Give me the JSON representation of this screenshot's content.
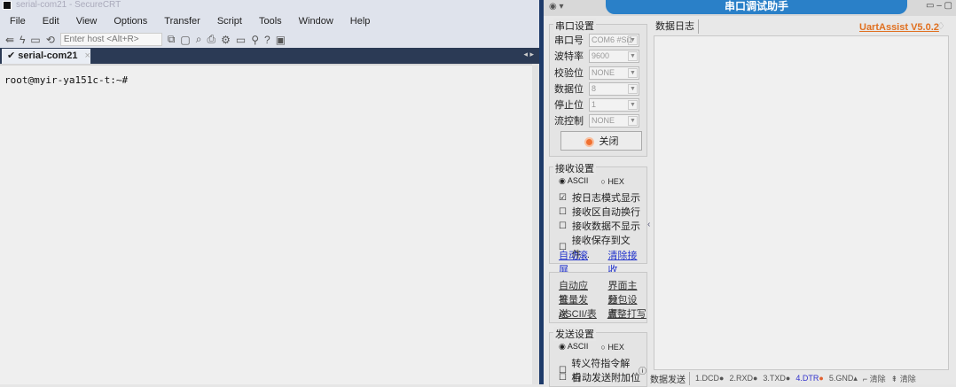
{
  "securecrt": {
    "window_title": "serial-com21 - SecureCRT",
    "menu": [
      "File",
      "Edit",
      "View",
      "Options",
      "Transfer",
      "Script",
      "Tools",
      "Window",
      "Help"
    ],
    "host_placeholder": "Enter host <Alt+R>",
    "tab_label": "serial-com21",
    "tab_close": "×",
    "terminal_text": "root@myir-ya151c-t:~#"
  },
  "uart": {
    "title": "串口调试助手",
    "version_link": "UartAssist V5.0.2",
    "log_tab": "数据日志",
    "port_settings": {
      "title": "串口设置",
      "fields": [
        {
          "label": "串口号",
          "value": "COM6 #Si1"
        },
        {
          "label": "波特率",
          "value": "9600"
        },
        {
          "label": "校验位",
          "value": "NONE"
        },
        {
          "label": "数据位",
          "value": "8"
        },
        {
          "label": "停止位",
          "value": "1"
        },
        {
          "label": "流控制",
          "value": "NONE"
        }
      ],
      "close_button": "关闭"
    },
    "receive_settings": {
      "title": "接收设置",
      "radio_ascii": "ASCII",
      "radio_hex": "HEX",
      "options": [
        {
          "label": "按日志模式显示",
          "checked": true
        },
        {
          "label": "接收区自动换行",
          "checked": false
        },
        {
          "label": "接收数据不显示",
          "checked": false
        },
        {
          "label": "接收保存到文件...",
          "checked": false
        }
      ],
      "link_autoscroll": "自动滚屏",
      "link_clear": "清除接收"
    },
    "tools": [
      "自动应答",
      "界面主题",
      "批量发送",
      "分包设置",
      "ASCII/表",
      "点整打写"
    ],
    "send_settings": {
      "title": "发送设置",
      "radio_ascii": "ASCII",
      "radio_hex": "HEX",
      "options": [
        {
          "label": "转义符指令解析",
          "checked": false
        },
        {
          "label": "自动发送附加位",
          "checked": false
        }
      ]
    },
    "bottom": {
      "send_tab": "数据发送",
      "pins": [
        "1.DCD",
        "2.RXD",
        "3.TXD",
        "4.DTR",
        "5.GND"
      ],
      "clear1": "清除",
      "clear2": "清除"
    }
  }
}
